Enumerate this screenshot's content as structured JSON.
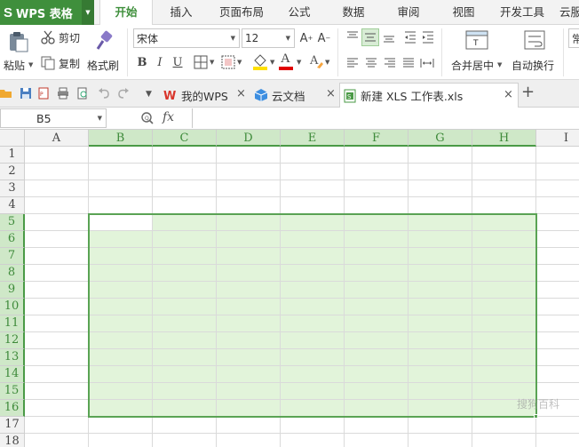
{
  "app": {
    "logo": "S",
    "title": "WPS 表格"
  },
  "menu": [
    {
      "label": "开始",
      "active": true
    },
    {
      "label": "插入"
    },
    {
      "label": "页面布局"
    },
    {
      "label": "公式"
    },
    {
      "label": "数据"
    },
    {
      "label": "审阅"
    },
    {
      "label": "视图"
    },
    {
      "label": "开发工具"
    },
    {
      "label": "云服"
    }
  ],
  "ribbon": {
    "paste_label": "粘贴",
    "cut_label": "剪切",
    "copy_label": "复制",
    "format_painter_label": "格式刷",
    "font_name": "宋体",
    "font_size": "12",
    "bold": "B",
    "italic": "I",
    "underline": "U",
    "merge_center_label": "合并居中",
    "wrap_text_label": "自动换行",
    "right_edge_label": "常"
  },
  "tabs": [
    {
      "label": "我的WPS"
    },
    {
      "label": "云文档"
    },
    {
      "label": "新建 XLS 工作表.xls",
      "active": true
    }
  ],
  "formula_bar": {
    "name_box": "B5",
    "fx": "fx",
    "formula": ""
  },
  "grid": {
    "columns": [
      "A",
      "B",
      "C",
      "D",
      "E",
      "F",
      "G",
      "H",
      "I"
    ],
    "rows": [
      "1",
      "2",
      "3",
      "4",
      "5",
      "6",
      "7",
      "8",
      "9",
      "10",
      "11",
      "12",
      "13",
      "14",
      "15",
      "16",
      "17",
      "18"
    ],
    "selection": "B5:H16",
    "active_cell": "B5"
  },
  "colors": {
    "accent": "#3f8f3c",
    "selection_fill": "#e2f4da",
    "selection_border": "#5aa354",
    "header_selected": "#cfe8c8"
  },
  "icons": {
    "paste": "paste-icon",
    "cut": "scissors-icon",
    "copy": "copy-icon",
    "format_painter": "brush-icon"
  },
  "watermark": "搜狗百科"
}
